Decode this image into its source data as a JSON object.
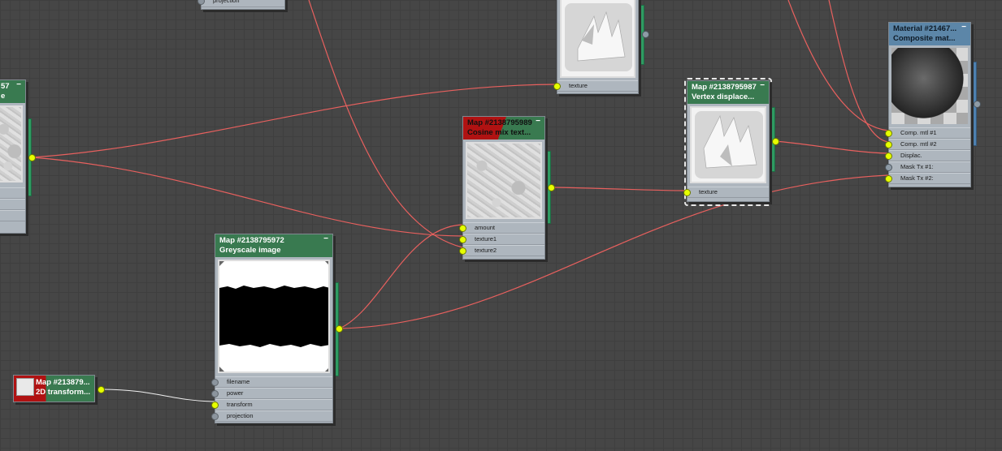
{
  "colors": {
    "canvas": "#464646",
    "wire": "#e8605e",
    "port_active": "#e6ff00",
    "header_green": "#397a50",
    "header_blue": "#5c86a8",
    "header_red": "#b01212"
  },
  "nodes": {
    "top_left_partial": {
      "port": "projection"
    },
    "left_partial": {
      "title1": "57",
      "title2": "e",
      "minus": "−"
    },
    "vertex_thumb_top": {
      "port": "texture"
    },
    "cosine_mix": {
      "title1": "Map #2138795989",
      "title2": "Cosine mix text...",
      "minus": "−",
      "ports": [
        "amount",
        "texture1",
        "texture2"
      ]
    },
    "vertex_displace": {
      "title1": "Map #2138795987",
      "title2": "Vertex displace...",
      "minus": "−",
      "port": "texture"
    },
    "composite_material": {
      "title1": "Material #21467...",
      "title2": "Composite mat...",
      "minus": "−",
      "ports": [
        "Comp. mtl #1",
        "Comp. mtl #2",
        "Displac.",
        "Mask Tx #1:",
        "Mask Tx #2:"
      ]
    },
    "greyscale_image": {
      "title1": "Map #2138795972",
      "title2": "Greyscale image",
      "minus": "−",
      "ports": [
        "filename",
        "power",
        "transform",
        "projection"
      ]
    },
    "transform_2d": {
      "title1": "Map #213879...",
      "title2": "2D transform..."
    }
  }
}
